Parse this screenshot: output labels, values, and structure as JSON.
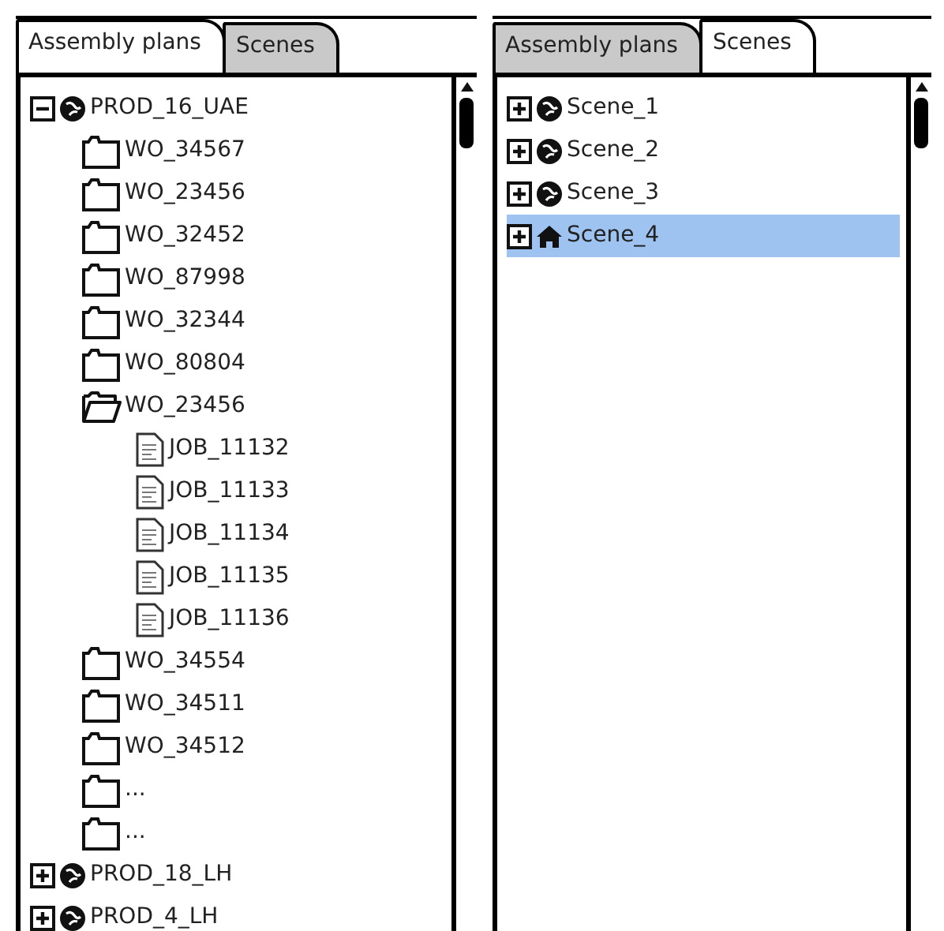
{
  "panels": [
    {
      "tabs": [
        {
          "label": "Assembly plans",
          "selected": true
        },
        {
          "label": "Scenes",
          "selected": false
        }
      ],
      "tree": [
        {
          "label": "PROD_16_UAE",
          "kind": "globe",
          "expanded": true,
          "children": [
            {
              "label": "WO_34567",
              "kind": "folder",
              "expanded": false
            },
            {
              "label": "WO_23456",
              "kind": "folder",
              "expanded": false
            },
            {
              "label": "WO_32452",
              "kind": "folder",
              "expanded": false
            },
            {
              "label": "WO_87998",
              "kind": "folder",
              "expanded": false
            },
            {
              "label": "WO_32344",
              "kind": "folder",
              "expanded": false
            },
            {
              "label": "WO_80804",
              "kind": "folder",
              "expanded": false
            },
            {
              "label": "WO_23456",
              "kind": "folder",
              "expanded": true,
              "children": [
                {
                  "label": "JOB_11132",
                  "kind": "document"
                },
                {
                  "label": "JOB_11133",
                  "kind": "document"
                },
                {
                  "label": "JOB_11134",
                  "kind": "document"
                },
                {
                  "label": "JOB_11135",
                  "kind": "document"
                },
                {
                  "label": "JOB_11136",
                  "kind": "document"
                }
              ]
            },
            {
              "label": "WO_34554",
              "kind": "folder",
              "expanded": false
            },
            {
              "label": "WO_34511",
              "kind": "folder",
              "expanded": false
            },
            {
              "label": "WO_34512",
              "kind": "folder",
              "expanded": false
            },
            {
              "label": "...",
              "kind": "folder",
              "expanded": false
            },
            {
              "label": "...",
              "kind": "folder",
              "expanded": false
            }
          ]
        },
        {
          "label": "PROD_18_LH",
          "kind": "globe",
          "expanded": false
        },
        {
          "label": "PROD_4_LH",
          "kind": "globe",
          "expanded": false
        }
      ]
    },
    {
      "tabs": [
        {
          "label": "Assembly plans",
          "selected": false
        },
        {
          "label": "Scenes",
          "selected": true
        }
      ],
      "tree": [
        {
          "label": "Scene_1",
          "kind": "globe",
          "expanded": false,
          "selected": false
        },
        {
          "label": "Scene_2",
          "kind": "globe",
          "expanded": false,
          "selected": false
        },
        {
          "label": "Scene_3",
          "kind": "globe",
          "expanded": false,
          "selected": false
        },
        {
          "label": "Scene_4",
          "kind": "home",
          "expanded": false,
          "selected": true
        }
      ]
    }
  ]
}
